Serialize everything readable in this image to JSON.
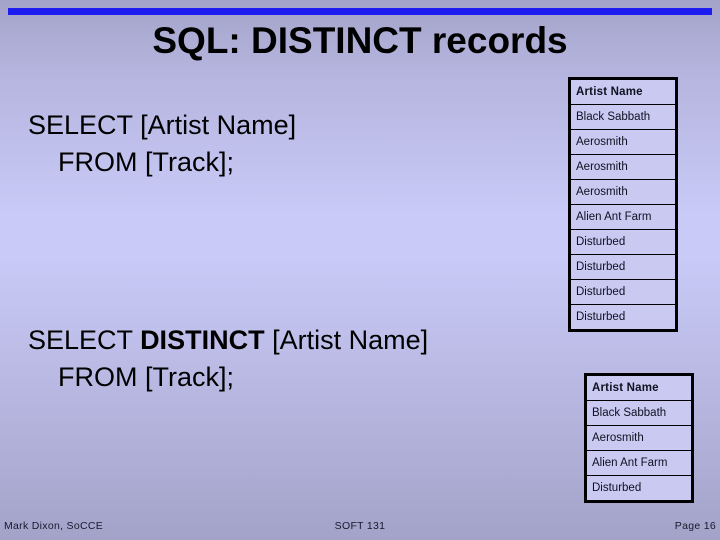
{
  "slide": {
    "title": "SQL: DISTINCT records",
    "accent_color": "#1d1df0",
    "background_light": "#cacaf8",
    "background_dark": "#a3a3c9"
  },
  "code_blocks": [
    {
      "id": "plain-select",
      "line1_part1": "SELECT ",
      "line1_keyword": "",
      "line1_part2": "[Artist Name]",
      "line2": "FROM [Track];"
    },
    {
      "id": "distinct-select",
      "line1_part1": "SELECT ",
      "line1_keyword": "DISTINCT",
      "line1_part2": " [Artist Name]",
      "line2": "FROM [Track];"
    }
  ],
  "tables": {
    "all_records": {
      "header": "Artist Name",
      "rows": [
        "Black Sabbath",
        "Aerosmith",
        "Aerosmith",
        "Aerosmith",
        "Alien Ant Farm",
        "Disturbed",
        "Disturbed",
        "Disturbed",
        "Disturbed"
      ]
    },
    "distinct_records": {
      "header": "Artist Name",
      "rows": [
        "Black Sabbath",
        "Aerosmith",
        "Alien Ant Farm",
        "Disturbed"
      ]
    }
  },
  "footer": {
    "left": "Mark Dixon, SoCCE",
    "center": "SOFT 131",
    "right": "Page 16"
  }
}
